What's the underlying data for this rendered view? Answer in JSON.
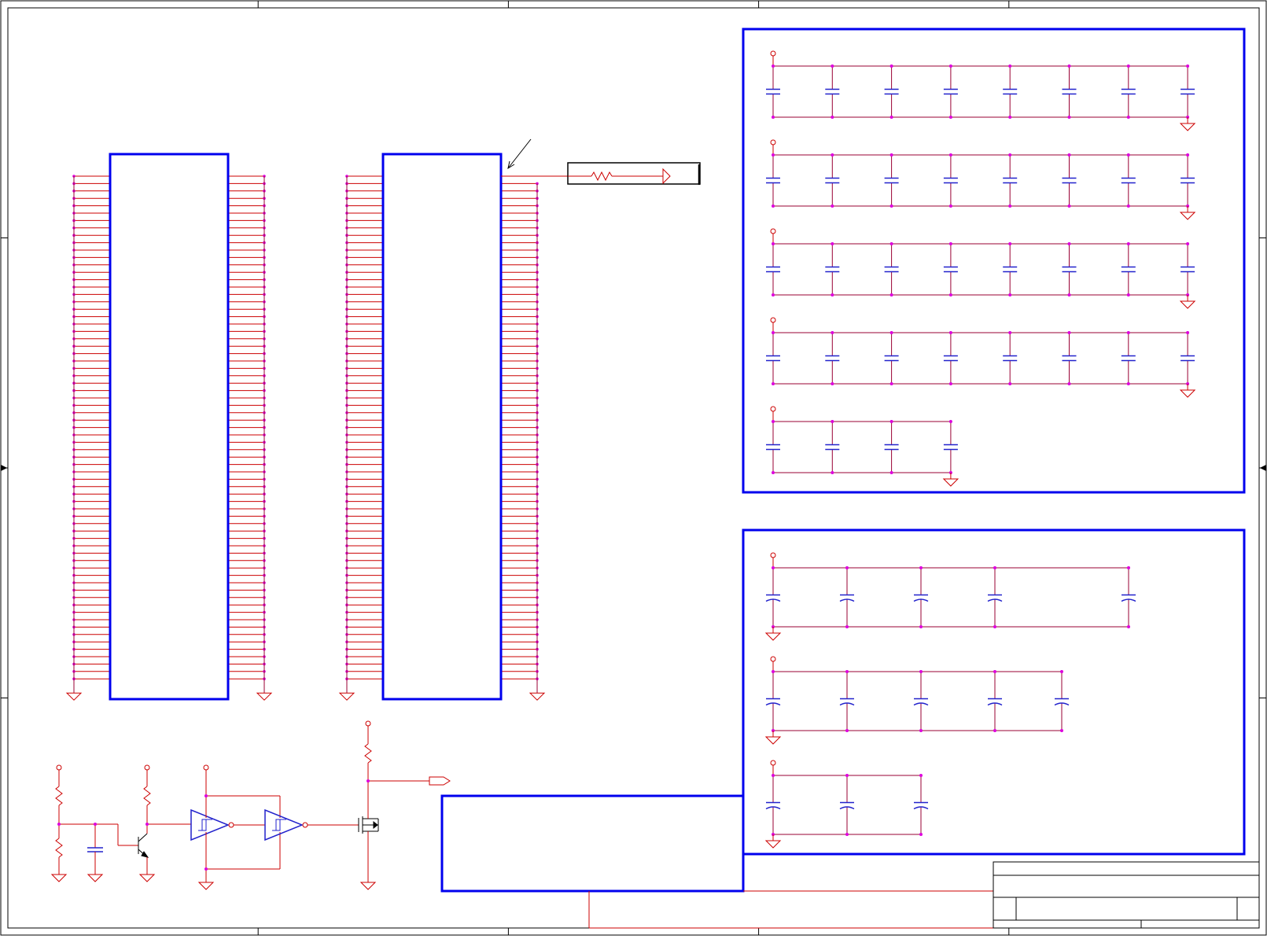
{
  "sheet": {
    "kind": "schematic",
    "zones": {
      "columns": 5,
      "rows": 4
    },
    "colors": {
      "frame": "#000000",
      "block": "#0000ee",
      "wire": "#cc0000",
      "net": "#990033",
      "junction": "#dd00dd",
      "component": "#2222cc"
    }
  },
  "connector_a": {
    "pins_per_side": 69,
    "ground_symbols": 2
  },
  "connector_b": {
    "pins_per_side": 69,
    "ground_symbols": 2,
    "series_resistor": true,
    "annotation_arrow": true
  },
  "decoupling_block_1": {
    "rows": [
      {
        "capacitors": 8
      },
      {
        "capacitors": 8
      },
      {
        "capacitors": 8
      },
      {
        "capacitors": 8
      },
      {
        "capacitors": 4
      }
    ]
  },
  "decoupling_block_2": {
    "rows": [
      {
        "capacitors": 5
      },
      {
        "capacitors": 5
      },
      {
        "capacitors": 3
      }
    ]
  },
  "reset_circuit": {
    "buffers": 2,
    "transistor": "npn",
    "mosfet": true,
    "output_port": true
  },
  "note_box": {
    "text": ""
  },
  "title_block": {
    "title": "",
    "sheet": ""
  }
}
